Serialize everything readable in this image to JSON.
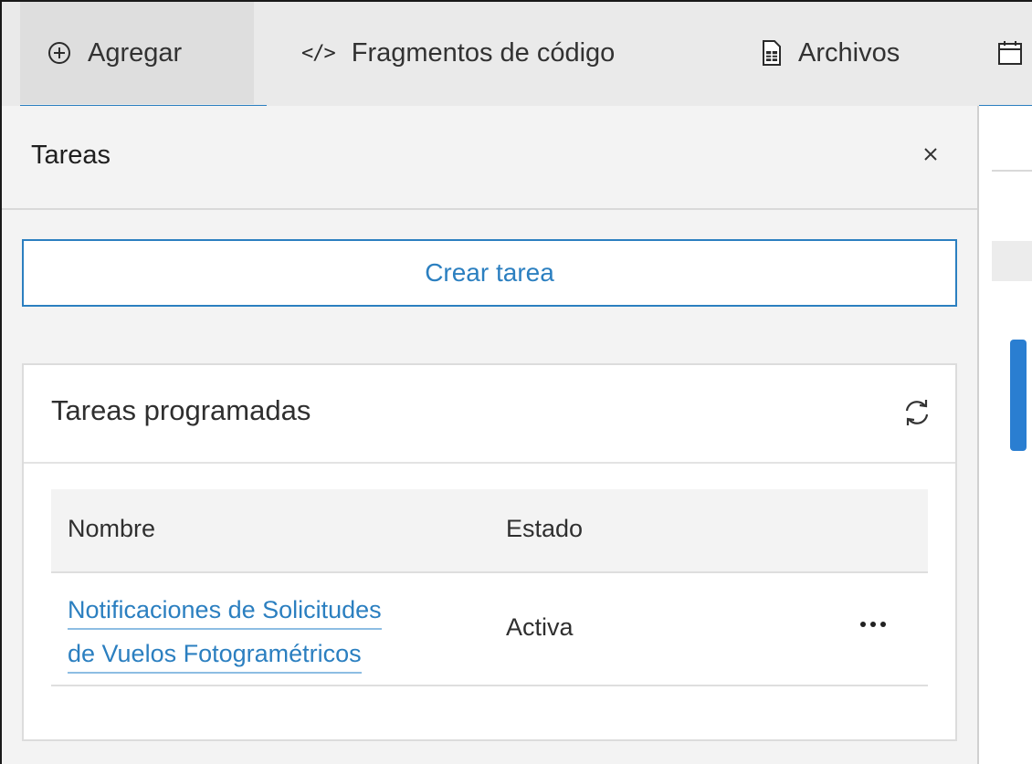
{
  "toolbar": {
    "items": [
      {
        "label": "Agregar",
        "icon": "plus-circle-icon",
        "active": true
      },
      {
        "label": "Fragmentos de código",
        "icon": "code-icon"
      },
      {
        "label": "Archivos",
        "icon": "file-icon"
      },
      {
        "label": "",
        "icon": "calendar-icon"
      }
    ]
  },
  "panel": {
    "title": "Tareas",
    "create_button": "Crear tarea",
    "scheduled": {
      "title": "Tareas programadas",
      "columns": [
        "Nombre",
        "Estado"
      ],
      "rows": [
        {
          "name_line1": "Notificaciones de Solicitudes",
          "name_line2": "de Vuelos Fotogramétricos",
          "status": "Activa"
        }
      ]
    }
  },
  "colors": {
    "accent": "#2b7fc0",
    "toolbar_bg": "#eaeaea",
    "panel_bg": "#f3f3f3"
  }
}
